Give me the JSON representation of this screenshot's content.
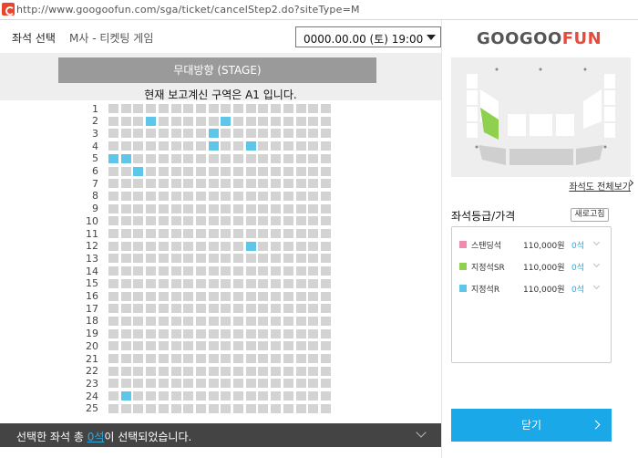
{
  "browser": {
    "url": "http://www.googoofun.com/sga/ticket/cancelStep2.do?siteType=M"
  },
  "header": {
    "section_title": "좌석 선택",
    "event_name": "M사 - 티켓팅 게임",
    "date_selected": "0000.00.00 (토) 19:00"
  },
  "stage": {
    "label": "무대방향 (STAGE)",
    "current_zone": "현재 보고계신 구역은 A1 입니다."
  },
  "seatmap": {
    "rows": [
      "1",
      "2",
      "3",
      "4",
      "5",
      "6",
      "7",
      "8",
      "9",
      "10",
      "11",
      "12",
      "13",
      "14",
      "15",
      "16",
      "17",
      "18",
      "19",
      "20",
      "21",
      "22",
      "23",
      "24",
      "25"
    ],
    "seats_per_row": 18,
    "available_seats": [
      {
        "row": 2,
        "seat": 4
      },
      {
        "row": 2,
        "seat": 10
      },
      {
        "row": 3,
        "seat": 9
      },
      {
        "row": 4,
        "seat": 9
      },
      {
        "row": 4,
        "seat": 12
      },
      {
        "row": 5,
        "seat": 1
      },
      {
        "row": 5,
        "seat": 2
      },
      {
        "row": 6,
        "seat": 3
      },
      {
        "row": 12,
        "seat": 12
      },
      {
        "row": 24,
        "seat": 2
      }
    ],
    "colors": {
      "empty": "#d3d3d3",
      "available": "#5ec6e8"
    }
  },
  "bottom_bar": {
    "prefix": "선택한 좌석 총 ",
    "count": "0석",
    "suffix": "이 선택되었습니다."
  },
  "sidebar": {
    "logo_left": "GOOGOO",
    "logo_right": "FUN",
    "full_map_link": "좌석도 전체보기",
    "grade_title": "좌석등급/가격",
    "refresh_label": "새로고침",
    "grades": [
      {
        "name": "스탠딩석",
        "price": "110,000원",
        "remaining": "0석",
        "color": "#f08bb0"
      },
      {
        "name": "지정석SR",
        "price": "110,000원",
        "remaining": "0석",
        "color": "#8fd14f"
      },
      {
        "name": "지정석R",
        "price": "110,000원",
        "remaining": "0석",
        "color": "#5ec6e8"
      }
    ],
    "close_label": "닫기"
  }
}
